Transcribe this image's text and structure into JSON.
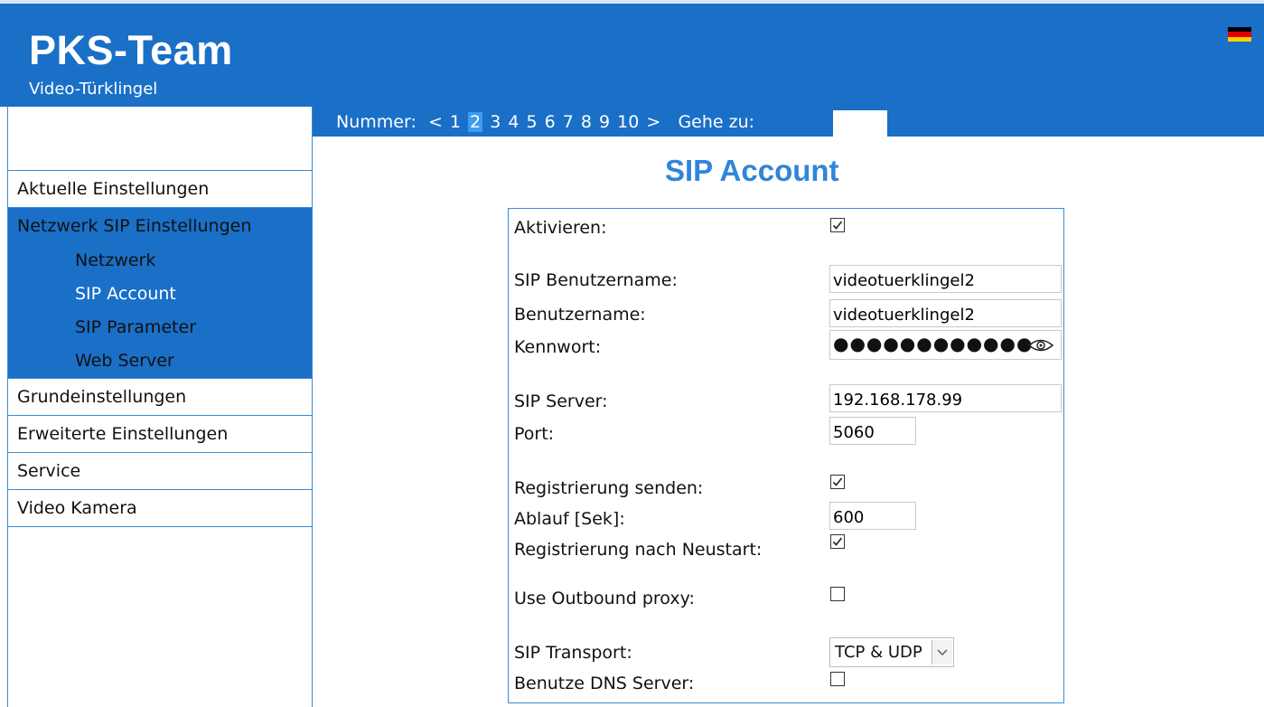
{
  "header": {
    "title": "PKS-Team",
    "subtitle": "Video-Türklingel"
  },
  "colors": {
    "brand_blue": "#1a6fc7",
    "title_blue": "#2f86d8"
  },
  "nav": {
    "nummer_label": "Nummer:",
    "prev": "<",
    "numbers": [
      "1",
      "2",
      "3",
      "4",
      "5",
      "6",
      "7",
      "8",
      "9",
      "10"
    ],
    "selected": "2",
    "next": ">",
    "goto_label": "Gehe zu:",
    "goto_value": ""
  },
  "sidebar": {
    "items": [
      {
        "label": "Aktuelle Einstellungen"
      },
      {
        "label": "Netzwerk SIP Einstellungen",
        "children": [
          {
            "label": "Netzwerk"
          },
          {
            "label": "SIP Account"
          },
          {
            "label": "SIP Parameter"
          },
          {
            "label": "Web Server"
          }
        ]
      },
      {
        "label": "Grundeinstellungen"
      },
      {
        "label": "Erweiterte Einstellungen"
      },
      {
        "label": "Service"
      },
      {
        "label": "Video Kamera"
      }
    ]
  },
  "page": {
    "title": "SIP Account"
  },
  "form": {
    "aktivieren": {
      "label": "Aktivieren:",
      "checked": true
    },
    "sip_username": {
      "label": "SIP Benutzername:",
      "value": "videotuerklingel2"
    },
    "username": {
      "label": "Benutzername:",
      "value": "videotuerklingel2"
    },
    "password": {
      "label": "Kennwort:",
      "masked": "●●●●●●●●●●●●",
      "icon": "eye-icon"
    },
    "sip_server": {
      "label": "SIP Server:",
      "value": "192.168.178.99"
    },
    "port": {
      "label": "Port:",
      "value": "5060"
    },
    "send_registration": {
      "label": "Registrierung senden:",
      "checked": true
    },
    "expiry": {
      "label": "Ablauf [Sek]:",
      "value": "600"
    },
    "register_after_restart": {
      "label": "Registrierung nach Neustart:",
      "checked": true
    },
    "outbound_proxy": {
      "label": "Use Outbound proxy:",
      "checked": false
    },
    "transport": {
      "label": "SIP Transport:",
      "value": "TCP & UDP"
    },
    "dns_server": {
      "label": "Benutze DNS Server:",
      "checked": false
    }
  }
}
